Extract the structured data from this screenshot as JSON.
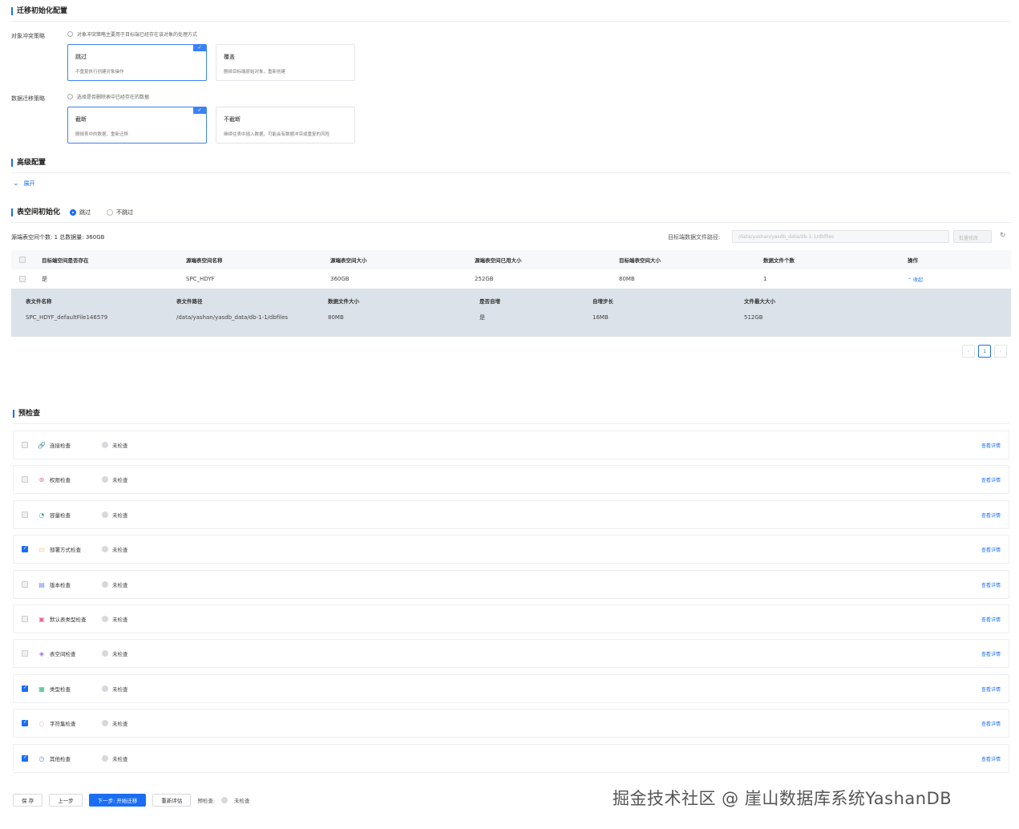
{
  "migration": {
    "title": "迁移初始化配置",
    "conflict": {
      "label": "对象冲突策略",
      "hint": "对象冲突策略主要用于目标端已经存在该对象的处理方式",
      "options": [
        {
          "title": "跳过",
          "desc": "不重复执行创建对象操作",
          "selected": true
        },
        {
          "title": "覆盖",
          "desc": "删掉目标端原始对象，重新创建",
          "selected": false
        }
      ]
    },
    "data_strategy": {
      "label": "数据迁移策略",
      "hint": "选择是否删除表中已经存在的数据",
      "options": [
        {
          "title": "截断",
          "desc": "删掉表中的数据，重新迁移",
          "selected": true
        },
        {
          "title": "不截断",
          "desc": "继续往表中插入数据，可能会有数据冲突或重复的风险",
          "selected": false
        }
      ]
    }
  },
  "advanced": {
    "title": "高级配置",
    "expand_label": "展开"
  },
  "tablespace": {
    "title": "表空间初始化",
    "radio_skip": "跳过",
    "radio_noskip": "不跳过",
    "stats": "源端表空间个数:  1      总数据量:  360GB",
    "path_label": "目标端数据文件路径:",
    "path_value": "/data/yashan/yasdb_data/db-1-1/dbfiles",
    "batch_button": "批量修改",
    "refresh_icon": "refresh-icon",
    "columns": [
      "目标端空间是否存在",
      "源端表空间名称",
      "源端表空间大小",
      "源端表空间已用大小",
      "目标端表空间大小",
      "数据文件个数",
      "操作"
    ],
    "row": {
      "exists": "是",
      "name": "SPC_HDYF",
      "size": "360GB",
      "used": "252GB",
      "target": "80MB",
      "count": "1",
      "action": "收起"
    },
    "sub_columns": [
      "表文件名称",
      "表文件路径",
      "数据文件大小",
      "是否自增",
      "自增步长",
      "文件最大大小"
    ],
    "sub_row": [
      "SPC_HDYF_defaultFile146579",
      "/data/yashan/yasdb_data/db-1-1/dbfiles",
      "80MB",
      "是",
      "16MB",
      "512GB"
    ],
    "pager": {
      "prev": "‹",
      "page": "1",
      "next": "›"
    }
  },
  "precheck": {
    "title": "预检查",
    "status": "未检查",
    "link": "查看详情",
    "items": [
      {
        "name": "连接检查",
        "icon": "🔗",
        "checked": false,
        "color": "#5b8def"
      },
      {
        "name": "权限检查",
        "icon": "⊚",
        "checked": false,
        "color": "#e06b8b"
      },
      {
        "name": "容量检查",
        "icon": "◔",
        "checked": false,
        "color": "#3bb37a"
      },
      {
        "name": "部署方式检查",
        "icon": "▭",
        "checked": true,
        "color": "#f0b23d"
      },
      {
        "name": "版本检查",
        "icon": "▤",
        "checked": false,
        "color": "#5b8def"
      },
      {
        "name": "默认表类型检查",
        "icon": "▣",
        "checked": false,
        "color": "#e06b8b"
      },
      {
        "name": "表空间检查",
        "icon": "◈",
        "checked": false,
        "color": "#9b6bdf"
      },
      {
        "name": "类型检查",
        "icon": "▦",
        "checked": true,
        "color": "#3bb37a"
      },
      {
        "name": "字符集检查",
        "icon": "◌",
        "checked": true,
        "color": "#e06b6b"
      },
      {
        "name": "其他检查",
        "icon": "◷",
        "checked": true,
        "color": "#5b8def"
      }
    ]
  },
  "footer": {
    "save": "保 存",
    "prev": "上一步",
    "next": "下一步: 开始迁移",
    "reassess": "重新评估",
    "precheck_label": "预检查:",
    "precheck_status": "未检查"
  },
  "watermark": "掘金技术社区 @ 崖山数据库系统YashanDB"
}
